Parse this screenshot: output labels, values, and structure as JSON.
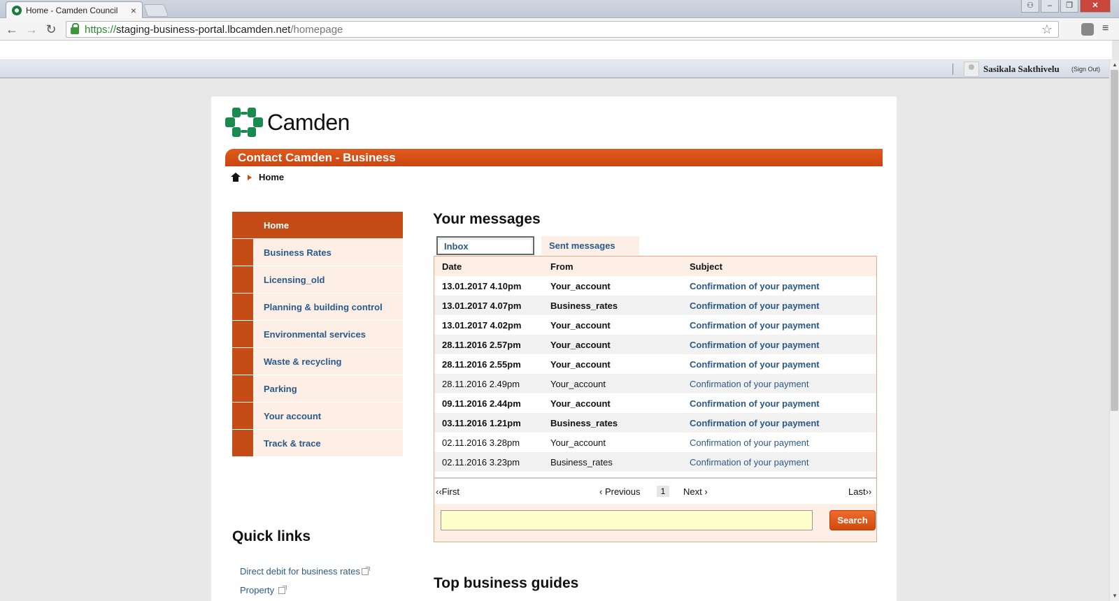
{
  "browser": {
    "tab_title": "Home - Camden Council",
    "tab_close": "×",
    "window_controls": {
      "user": "⚇",
      "minimize": "–",
      "maximize": "❐",
      "close": "✕"
    },
    "url": {
      "scheme": "https://",
      "host": "staging-business-portal.lbcamden.net",
      "path": "/homepage"
    },
    "icons": {
      "back": "←",
      "forward": "→",
      "reload": "↻",
      "star": "☆",
      "menu": "≡"
    }
  },
  "userbar": {
    "user_name": "Sasikala Sakthivelu",
    "sign_out": "(Sign Out)"
  },
  "site": {
    "logo_text": "Camden",
    "banner": "Contact Camden - Business",
    "breadcrumb_current": "Home"
  },
  "sidebar": {
    "items": [
      {
        "label": "Home",
        "active": true
      },
      {
        "label": "Business Rates"
      },
      {
        "label": "Licensing_old"
      },
      {
        "label": "Planning & building control"
      },
      {
        "label": "Environmental services"
      },
      {
        "label": "Waste & recycling"
      },
      {
        "label": "Parking"
      },
      {
        "label": "Your account"
      },
      {
        "label": "Track & trace"
      }
    ]
  },
  "quick_links": {
    "title": "Quick links",
    "items": [
      "Direct debit for business rates",
      "Property"
    ]
  },
  "messages": {
    "title": "Your messages",
    "tabs": {
      "inbox": "Inbox",
      "sent": "Sent messages"
    },
    "columns": [
      "Date",
      "From",
      "Subject"
    ],
    "rows": [
      {
        "date": "13.01.2017 4.10pm",
        "from": "Your_account",
        "subject": "Confirmation of your payment",
        "unread": true
      },
      {
        "date": "13.01.2017 4.07pm",
        "from": "Business_rates",
        "subject": "Confirmation of your payment",
        "unread": true
      },
      {
        "date": "13.01.2017 4.02pm",
        "from": "Your_account",
        "subject": "Confirmation of your payment",
        "unread": true
      },
      {
        "date": "28.11.2016 2.57pm",
        "from": "Your_account",
        "subject": "Confirmation of your payment",
        "unread": true
      },
      {
        "date": "28.11.2016 2.55pm",
        "from": "Your_account",
        "subject": "Confirmation of your payment",
        "unread": true
      },
      {
        "date": "28.11.2016 2.49pm",
        "from": "Your_account",
        "subject": "Confirmation of your payment",
        "unread": false
      },
      {
        "date": "09.11.2016 2.44pm",
        "from": "Your_account",
        "subject": "Confirmation of your payment",
        "unread": true
      },
      {
        "date": "03.11.2016 1.21pm",
        "from": "Business_rates",
        "subject": "Confirmation of your payment",
        "unread": true
      },
      {
        "date": "02.11.2016 3.28pm",
        "from": "Your_account",
        "subject": "Confirmation of your payment",
        "unread": false
      },
      {
        "date": "02.11.2016 3.23pm",
        "from": "Business_rates",
        "subject": "Confirmation of your payment",
        "unread": false
      }
    ],
    "pager": {
      "first": "‹‹First",
      "previous": "‹ Previous",
      "page": "1",
      "next": "Next ›",
      "last": "Last››"
    },
    "search": {
      "value": "",
      "button": "Search"
    }
  },
  "guides": {
    "title": "Top business guides"
  },
  "colors": {
    "brand_orange": "#c64c17",
    "link_blue": "#2a5a8a",
    "logo_green": "#1b8a4f"
  }
}
